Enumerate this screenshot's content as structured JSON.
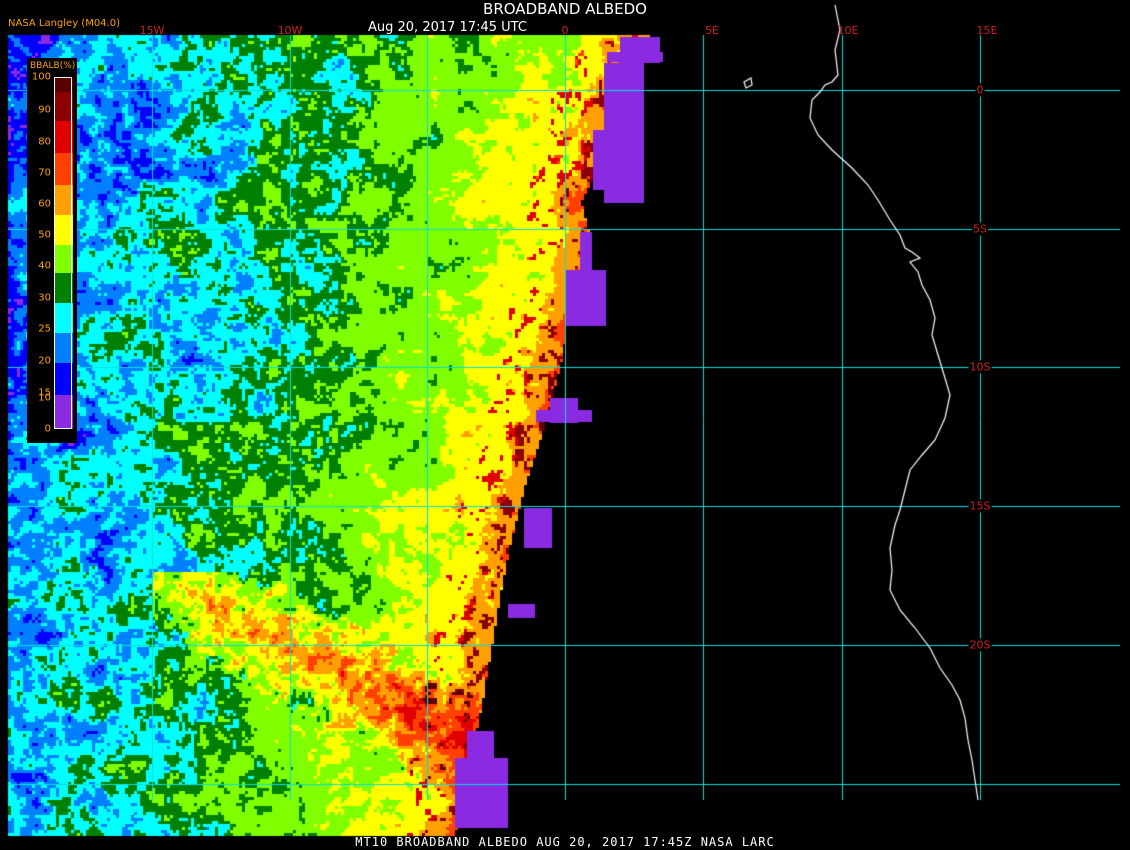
{
  "header": {
    "title": "BROADBAND ALBEDO",
    "timestamp": "Aug 20, 2017 17:45 UTC",
    "organization": "NASA Langley (M04.0)"
  },
  "footer": {
    "caption": "MT10  BROADBAND ALBEDO   AUG 20, 2017 17:45Z   NASA LARC"
  },
  "legend": {
    "title": "BBALB(%)",
    "ticks": [
      "100",
      "90",
      "80",
      "70",
      "60",
      "50",
      "40",
      "30",
      "25",
      "20",
      "15",
      "10",
      "0"
    ],
    "colors": [
      "#5a0000",
      "#8b0000",
      "#e00000",
      "#ff4000",
      "#ffa000",
      "#ffff00",
      "#80ff00",
      "#008000",
      "#00ffff",
      "#0080ff",
      "#0000ff",
      "#8a2be2"
    ]
  },
  "map": {
    "longitude_labels": [
      "15W",
      "10W",
      "0",
      "5E",
      "10E",
      "15E"
    ],
    "latitude_labels": [
      "0",
      "5S",
      "10S",
      "15S",
      "20S"
    ],
    "gridline_color": "#00e0e0",
    "coastline_color": "#ffffff",
    "label_color": "#d02020"
  }
}
